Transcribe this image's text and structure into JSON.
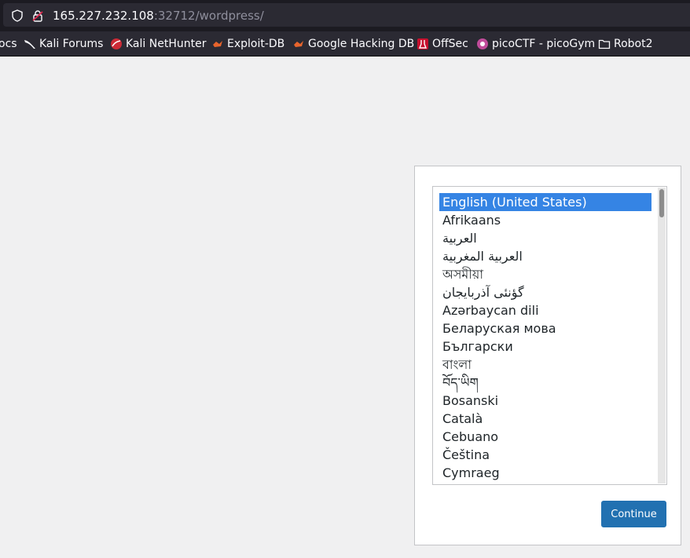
{
  "browser": {
    "url_host": "165.227.232.108",
    "url_path": ":32712/wordpress/"
  },
  "bookmarks": [
    {
      "label": "ocs",
      "icon": "none"
    },
    {
      "label": "Kali Forums",
      "icon": "kali-dragon-icon"
    },
    {
      "label": "Kali NetHunter",
      "icon": "nethunter-icon"
    },
    {
      "label": "Exploit-DB",
      "icon": "exploitdb-icon"
    },
    {
      "label": "Google Hacking DB",
      "icon": "ghdb-icon"
    },
    {
      "label": "OffSec",
      "icon": "offsec-icon"
    },
    {
      "label": "picoCTF - picoGym",
      "icon": "picoctf-icon"
    },
    {
      "label": "Robot2",
      "icon": "folder-icon"
    }
  ],
  "language_list": {
    "items": [
      "English (United States)",
      "Afrikaans",
      "العربية",
      "العربية المغربية",
      "অসমীয়া",
      "گؤنئی آذربایجان",
      "Azərbaycan dili",
      "Беларуская мова",
      "Български",
      "বাংলা",
      "བོད་ཡིག",
      "Bosanski",
      "Català",
      "Cebuano",
      "Čeština",
      "Cymraeg"
    ],
    "selected_index": 0
  },
  "continue_label": "Continue",
  "colors": {
    "selection": "#3584e4",
    "button": "#2271b1",
    "page_bg": "#f0f0f1"
  }
}
